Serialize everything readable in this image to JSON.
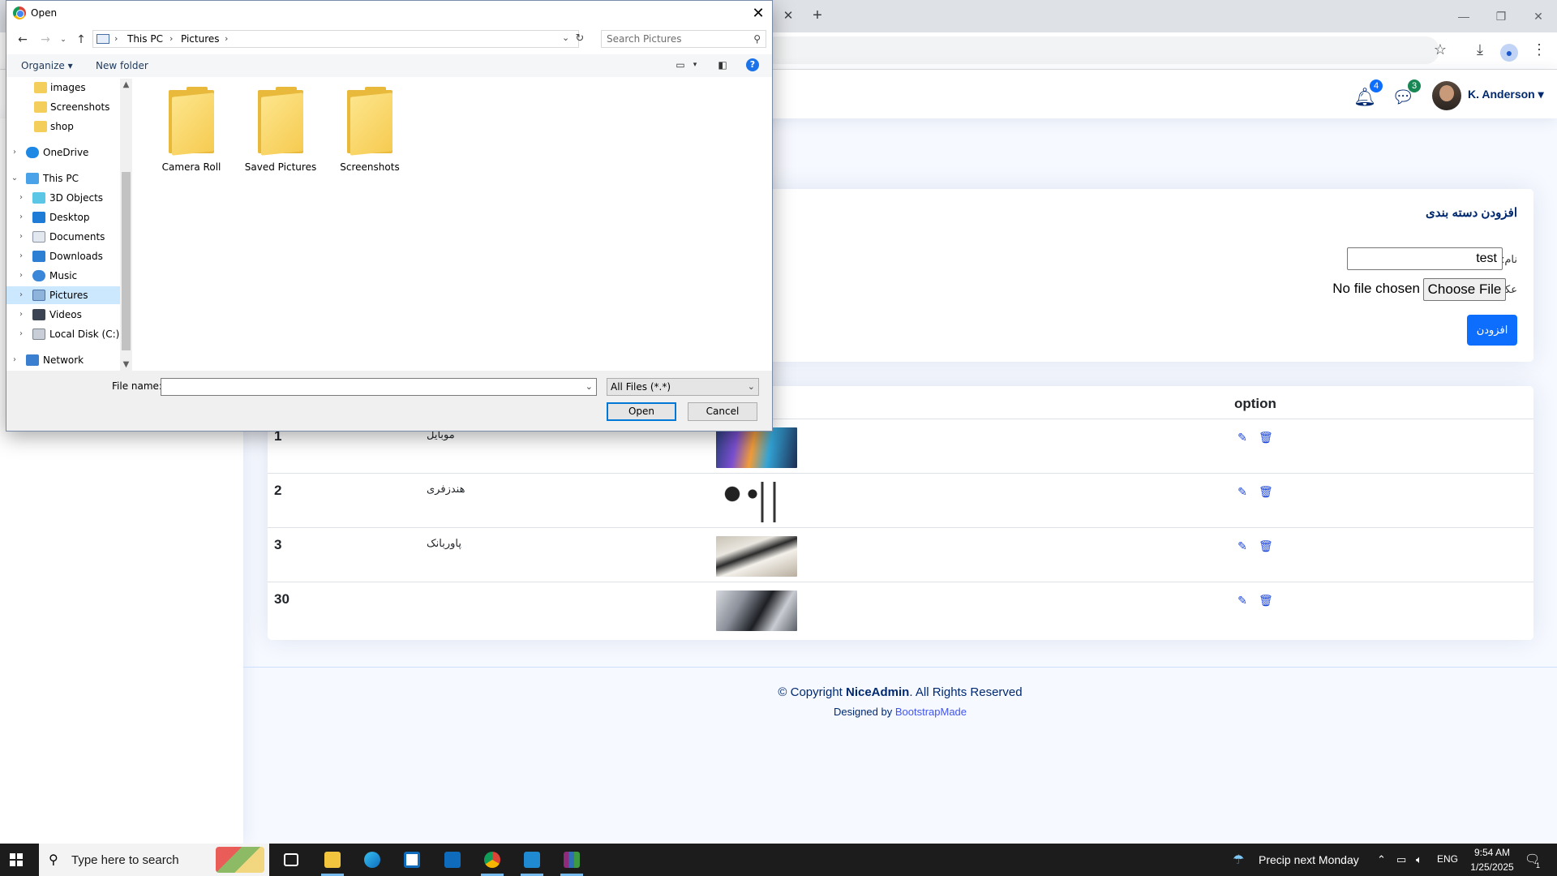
{
  "header": {
    "notifications_count": "4",
    "messages_count": "3",
    "user_name": "K. Anderson",
    "colors": {
      "navy": "#012970",
      "primary": "#0d6efd",
      "badge_blue": "#0d6efd",
      "badge_green": "#198754"
    }
  },
  "form": {
    "title": "افزودن دسته بندی",
    "name_label": "نام:",
    "name_value": "test",
    "image_label": "عکس:",
    "file_button": "Choose File",
    "file_status": "No file chosen",
    "submit_label": "افزودن"
  },
  "table": {
    "option_header": "option",
    "rows": [
      {
        "id": "1",
        "name": "موبایل",
        "image": "mobiles-photo"
      },
      {
        "id": "2",
        "name": "هندزفری",
        "image": "earphones-photo"
      },
      {
        "id": "3",
        "name": "پاوربانک",
        "image": "powerbank-photo"
      },
      {
        "id": "30",
        "name": "",
        "image": "gadgets-photo"
      }
    ]
  },
  "footer": {
    "copyright_prefix": "© Copyright",
    "brand": "NiceAdmin",
    "copyright_suffix": ". All Rights Reserved",
    "designed_by": "Designed by",
    "designer": "BootstrapMade"
  },
  "dialog": {
    "title": "Open",
    "breadcrumb": [
      "This PC",
      "Pictures"
    ],
    "search_placeholder": "Search Pictures",
    "organize_label": "Organize",
    "new_folder_label": "New folder",
    "nav_items": [
      {
        "label": "images",
        "icon": "folder-icon"
      },
      {
        "label": "Screenshots",
        "icon": "folder-icon"
      },
      {
        "label": "shop",
        "icon": "folder-icon"
      },
      {
        "label": "OneDrive",
        "icon": "cloud-icon"
      },
      {
        "label": "This PC",
        "icon": "computer-icon"
      },
      {
        "label": "3D Objects",
        "icon": "cube-icon"
      },
      {
        "label": "Desktop",
        "icon": "desktop-icon"
      },
      {
        "label": "Documents",
        "icon": "document-icon"
      },
      {
        "label": "Downloads",
        "icon": "download-icon"
      },
      {
        "label": "Music",
        "icon": "music-icon"
      },
      {
        "label": "Pictures",
        "icon": "pictures-icon"
      },
      {
        "label": "Videos",
        "icon": "video-icon"
      },
      {
        "label": "Local Disk (C:)",
        "icon": "disk-icon"
      },
      {
        "label": "Network",
        "icon": "network-icon"
      }
    ],
    "folders": [
      "Camera Roll",
      "Saved Pictures",
      "Screenshots"
    ],
    "file_name_label": "File name:",
    "file_name_value": "",
    "file_type": "All Files (*.*)",
    "open_label": "Open",
    "cancel_label": "Cancel"
  },
  "taskbar": {
    "search_placeholder": "Type here to search",
    "weather": "Precip next Monday",
    "language": "ENG",
    "time": "9:54 AM",
    "date": "1/25/2025",
    "notification_count": "1"
  }
}
